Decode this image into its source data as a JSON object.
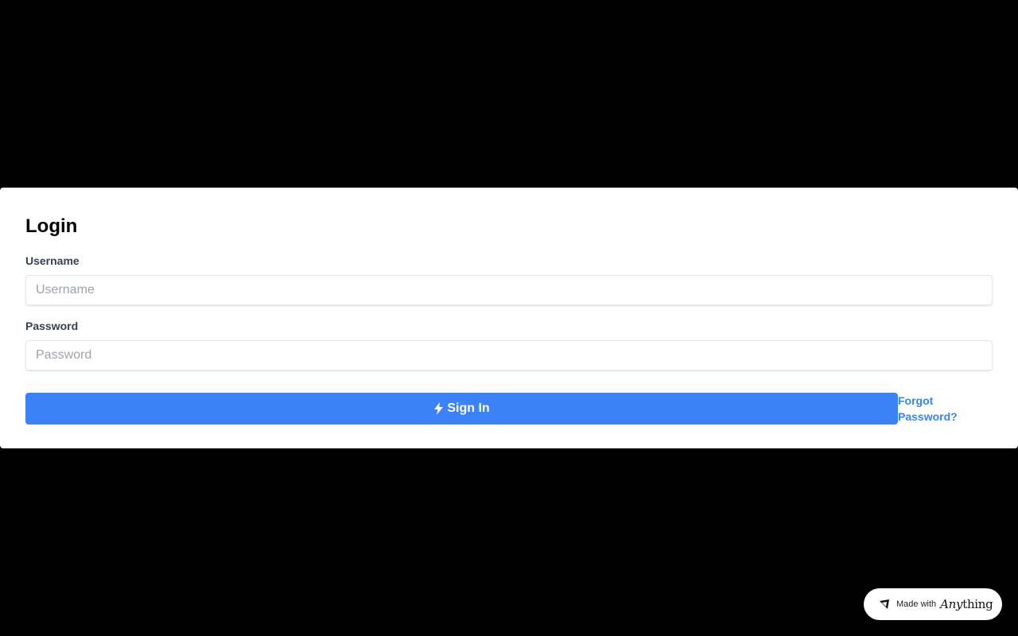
{
  "login": {
    "title": "Login",
    "username": {
      "label": "Username",
      "placeholder": "Username",
      "value": ""
    },
    "password": {
      "label": "Password",
      "placeholder": "Password",
      "value": ""
    },
    "sign_in_label": "Sign In",
    "sign_in_icon": "bolt-icon",
    "forgot_password_label": "Forgot Password?"
  },
  "badge": {
    "made_with": "Made with",
    "brand_prefix": "Any",
    "brand_suffix": "thing",
    "icon": "anything-logo-icon"
  },
  "colors": {
    "background": "#000000",
    "card": "#ffffff",
    "accent": "#3b82f6",
    "label_text": "#374151",
    "placeholder": "#9ca3af"
  }
}
